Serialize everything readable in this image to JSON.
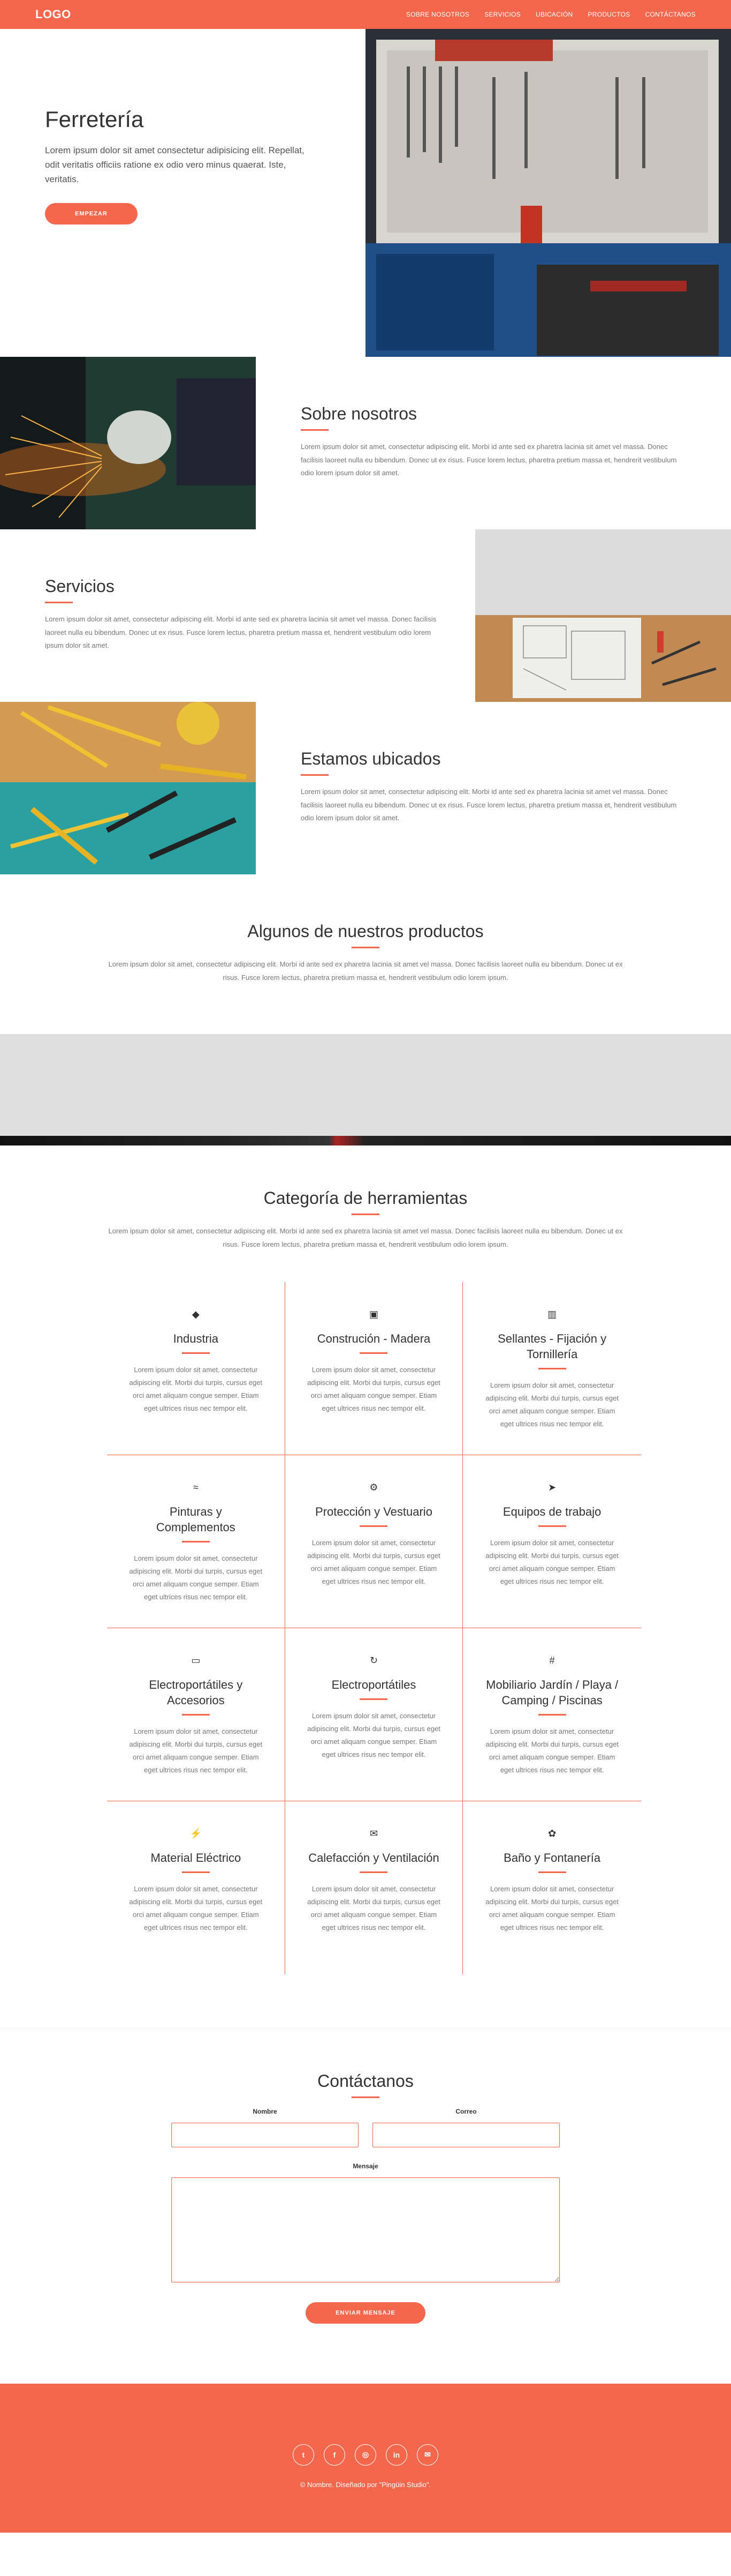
{
  "nav": {
    "logo": "LOGO",
    "items": [
      "Sobre nosotros",
      "Servicios",
      "Ubicación",
      "Productos",
      "Contáctanos"
    ]
  },
  "hero": {
    "title": "Ferretería",
    "desc": "Lorem ipsum dolor sit amet consectetur adipisicing elit. Repellat, odit veritatis officiis ratione ex odio vero minus quaerat. Iste, veritatis.",
    "button": "Empezar"
  },
  "about": {
    "title": "Sobre nosotros",
    "desc": "Lorem ipsum dolor sit amet, consectetur adipiscing elit. Morbi id ante sed ex pharetra lacinia sit amet vel massa. Donec facilisis laoreet nulla eu bibendum. Donec ut ex risus. Fusce lorem lectus, pharetra pretium massa et, hendrerit vestibulum odio lorem ipsum dolor sit amet."
  },
  "services": {
    "title": "Servicios",
    "desc": "Lorem ipsum dolor sit amet, consectetur adipiscing elit. Morbi id ante sed ex pharetra lacinia sit amet vel massa. Donec facilisis laoreet nulla eu bibendum. Donec ut ex risus. Fusce lorem lectus, pharetra pretium massa et, hendrerit vestibulum odio lorem ipsum dolor sit amet."
  },
  "location": {
    "title": "Estamos ubicados",
    "desc": "Lorem ipsum dolor sit amet, consectetur adipiscing elit. Morbi id ante sed ex pharetra lacinia sit amet vel massa. Donec facilisis laoreet nulla eu bibendum. Donec ut ex risus. Fusce lorem lectus, pharetra pretium massa et, hendrerit vestibulum odio lorem ipsum dolor sit amet."
  },
  "products": {
    "title": "Algunos de nuestros productos",
    "desc": "Lorem ipsum dolor sit amet, consectetur adipiscing elit. Morbi id ante sed ex pharetra lacinia sit amet vel massa. Donec facilisis laoreet nulla eu bibendum. Donec ut ex risus. Fusce lorem lectus, pharetra pretium massa et, hendrerit vestibulum odio lorem ipsum."
  },
  "categories": {
    "title": "Categoría de herramientas",
    "desc": "Lorem ipsum dolor sit amet, consectetur adipiscing elit. Morbi id ante sed ex pharetra lacinia sit amet vel massa. Donec facilisis laoreet nulla eu bibendum. Donec ut ex risus. Fusce lorem lectus, pharetra pretium massa et, hendrerit vestibulum odio lorem ipsum.",
    "items": [
      {
        "icon": "diamond-icon",
        "title": "Industria",
        "desc": "Lorem ipsum dolor sit amet, consectetur adipiscing elit. Morbi dui turpis, cursus eget orci amet aliquam congue semper. Etiam eget ultrices risus nec tempor elit."
      },
      {
        "icon": "floppy-disk-icon",
        "title": "Construción - Madera",
        "desc": "Lorem ipsum dolor sit amet, consectetur adipiscing elit. Morbi dui turpis, cursus eget orci amet aliquam congue semper. Etiam eget ultrices risus nec tempor elit."
      },
      {
        "icon": "bar-chart-icon",
        "title": "Sellantes - Fijación y Tornillería",
        "desc": "Lorem ipsum dolor sit amet, consectetur adipiscing elit. Morbi dui turpis, cursus eget orci amet aliquam congue semper. Etiam eget ultrices risus nec tempor elit."
      },
      {
        "icon": "wifi-icon",
        "title": "Pinturas y Complementos",
        "desc": "Lorem ipsum dolor sit amet, consectetur adipiscing elit. Morbi dui turpis, cursus eget orci amet aliquam congue semper. Etiam eget ultrices risus nec tempor elit."
      },
      {
        "icon": "gear-icon",
        "title": "Protección y Vestuario",
        "desc": "Lorem ipsum dolor sit amet, consectetur adipiscing elit. Morbi dui turpis, cursus eget orci amet aliquam congue semper. Etiam eget ultrices risus nec tempor elit."
      },
      {
        "icon": "paper-plane-icon",
        "title": "Equipos de trabajo",
        "desc": "Lorem ipsum dolor sit amet, consectetur adipiscing elit. Morbi dui turpis, cursus eget orci amet aliquam congue semper. Etiam eget ultrices risus nec tempor elit."
      },
      {
        "icon": "monitor-icon",
        "title": "Electroportátiles y Accesorios",
        "desc": "Lorem ipsum dolor sit amet, consectetur adipiscing elit. Morbi dui turpis, cursus eget orci amet aliquam congue semper. Etiam eget ultrices risus nec tempor elit."
      },
      {
        "icon": "refresh-icon",
        "title": "Electroportátiles",
        "desc": "Lorem ipsum dolor sit amet, consectetur adipiscing elit. Morbi dui turpis, cursus eget orci amet aliquam congue semper. Etiam eget ultrices risus nec tempor elit."
      },
      {
        "icon": "hashtag-icon",
        "title": "Mobiliario Jardín / Playa / Camping / Piscinas",
        "desc": "Lorem ipsum dolor sit amet, consectetur adipiscing elit. Morbi dui turpis, cursus eget orci amet aliquam congue semper. Etiam eget ultrices risus nec tempor elit."
      },
      {
        "icon": "bolt-icon",
        "title": "Material Eléctrico",
        "desc": "Lorem ipsum dolor sit amet, consectetur adipiscing elit. Morbi dui turpis, cursus eget orci amet aliquam congue semper. Etiam eget ultrices risus nec tempor elit."
      },
      {
        "icon": "envelope-icon",
        "title": "Calefacción y Ventilación",
        "desc": "Lorem ipsum dolor sit amet, consectetur adipiscing elit. Morbi dui turpis, cursus eget orci amet aliquam congue semper. Etiam eget ultrices risus nec tempor elit."
      },
      {
        "icon": "leaf-icon",
        "title": "Baño y Fontanería",
        "desc": "Lorem ipsum dolor sit amet, consectetur adipiscing elit. Morbi dui turpis, cursus eget orci amet aliquam congue semper. Etiam eget ultrices risus nec tempor elit."
      }
    ]
  },
  "contact": {
    "title": "Contáctanos",
    "name_label": "Nombre",
    "email_label": "Correo",
    "message_label": "Mensaje",
    "button": "Enviar mensaje"
  },
  "footer": {
    "social": [
      "twitter-icon",
      "facebook-icon",
      "instagram-icon",
      "linkedin-icon",
      "email-icon"
    ],
    "credit": "© Nombre. Diseñado por \"Pingüin Studio\"."
  },
  "colors": {
    "accent": "#f5674d",
    "band": "#dedede"
  }
}
